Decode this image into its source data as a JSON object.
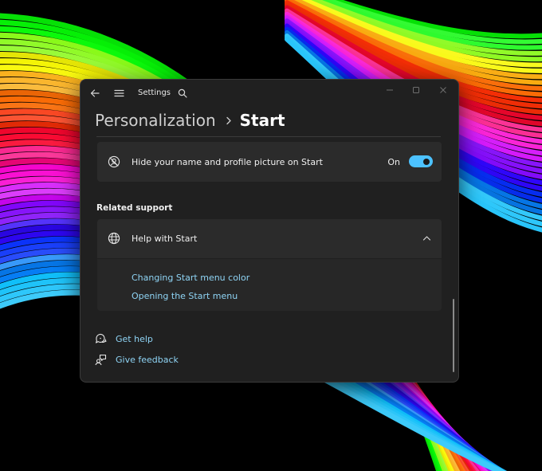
{
  "window": {
    "app_title": "Settings",
    "icons": {
      "back": "back-arrow-icon",
      "menu": "hamburger-menu-icon",
      "search": "search-icon",
      "minimize": "minimize-icon",
      "maximize": "maximize-icon",
      "close": "close-icon"
    }
  },
  "breadcrumb": {
    "parent": "Personalization",
    "separator_icon": "chevron-right-icon",
    "current": "Start"
  },
  "settings": {
    "hide_name": {
      "label": "Hide your name and profile picture on Start",
      "icon": "profile-hidden-icon",
      "state_label": "On",
      "enabled": true
    }
  },
  "related_support": {
    "title": "Related support",
    "help_card": {
      "label": "Help with Start",
      "icon": "globe-icon",
      "expanded": true,
      "links": [
        "Changing Start menu color",
        "Opening the Start menu"
      ]
    }
  },
  "footer_links": {
    "get_help": {
      "label": "Get help",
      "icon": "help-chat-icon"
    },
    "give_feedback": {
      "label": "Give feedback",
      "icon": "feedback-icon"
    }
  },
  "colors": {
    "accent": "#4cc2ff",
    "link": "#8fd4f5",
    "window_bg": "#202020",
    "card_bg": "#2b2b2b"
  }
}
